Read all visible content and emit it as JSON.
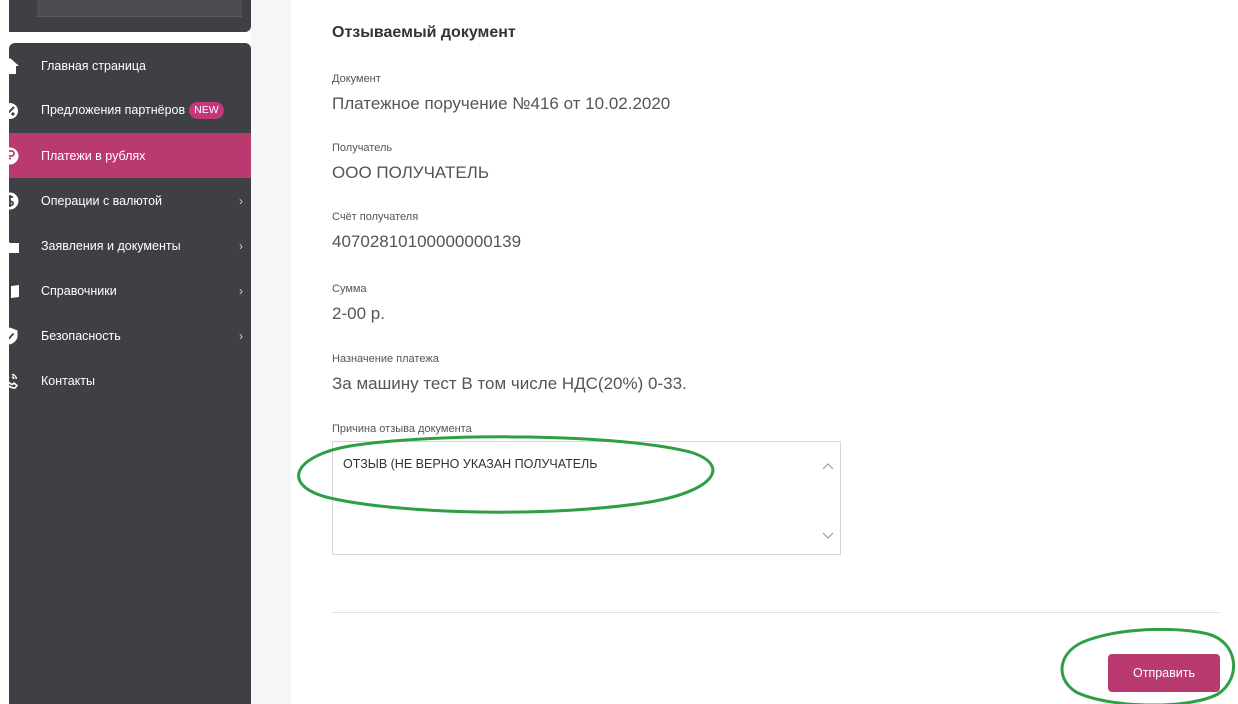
{
  "sidebar": {
    "items": [
      {
        "label": "Главная страница",
        "icon": "home-icon"
      },
      {
        "label": "Предложения партнёров",
        "badge": "NEW",
        "icon": "offers-badge-icon"
      },
      {
        "label": "Платежи в рублях",
        "icon": "ruble-icon",
        "active": true
      },
      {
        "label": "Операции с валютой",
        "icon": "dollar-icon",
        "chevron": "›"
      },
      {
        "label": "Заявления и документы",
        "icon": "folder-icon",
        "chevron": "›"
      },
      {
        "label": "Справочники",
        "icon": "book-icon",
        "chevron": "›"
      },
      {
        "label": "Безопасность",
        "icon": "shield-icon",
        "chevron": "›"
      },
      {
        "label": "Контакты",
        "icon": "phone-icon"
      }
    ]
  },
  "main": {
    "title": "Отзываемый документ",
    "fields": [
      {
        "label": "Документ",
        "value": "Платежное поручение №416 от 10.02.2020"
      },
      {
        "label": "Получатель",
        "value": "ООО ПОЛУЧАТЕЛЬ"
      },
      {
        "label": "Счёт получателя",
        "value": "40702810100000000139"
      },
      {
        "label": "Сумма",
        "value": "2-00 р."
      },
      {
        "label": "Назначение платежа",
        "value": "За машину тест В том числе НДС(20%) 0-33."
      }
    ],
    "reason": {
      "label": "Причина отзыва документа",
      "value": "ОТЗЫВ (НЕ ВЕРНО УКАЗАН ПОЛУЧАТЕЛЬ"
    },
    "submit_label": "Отправить"
  },
  "colors": {
    "sidebar_bg": "#3f3f46",
    "accent": "#b93a6e",
    "annotation": "#2ea043"
  }
}
